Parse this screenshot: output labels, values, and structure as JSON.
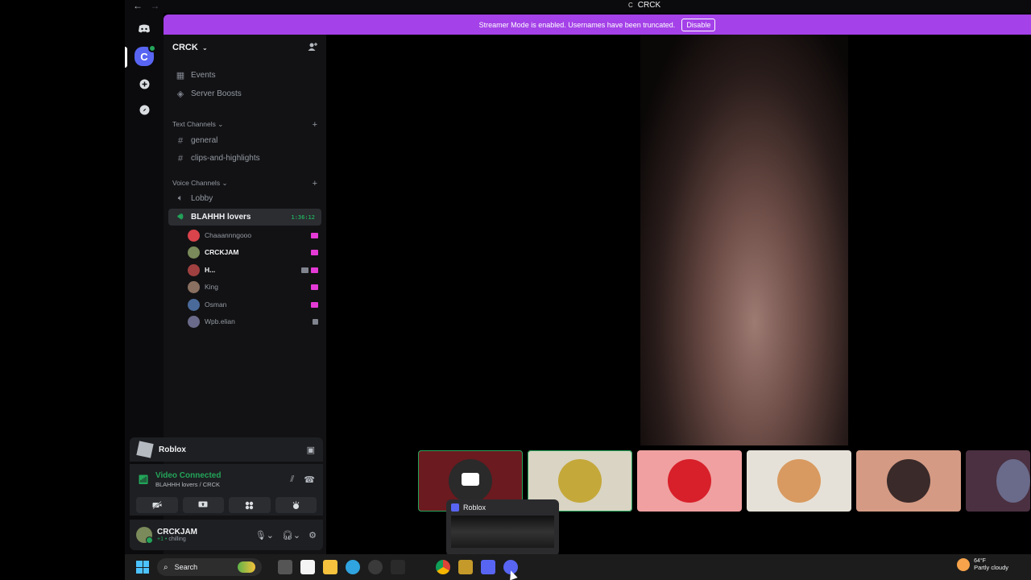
{
  "window": {
    "title": "CRCK",
    "title_icon": "C",
    "back": "←",
    "forward": "→"
  },
  "banner": {
    "message": "Streamer Mode is enabled. Usernames have been truncated.",
    "disable_label": "Disable"
  },
  "rail": {
    "server_initial": "C"
  },
  "server": {
    "name": "CRCK"
  },
  "sidebar": {
    "top_items": [
      {
        "label": "Events"
      },
      {
        "label": "Server Boosts"
      }
    ],
    "text_category": "Text Channels",
    "text_channels": [
      {
        "label": "general"
      },
      {
        "label": "clips-and-highlights"
      }
    ],
    "voice_category": "Voice Channels",
    "voice_channels": [
      {
        "label": "Lobby"
      },
      {
        "label": "BLAHHH lovers",
        "timer": "1:36:12"
      }
    ],
    "members": [
      {
        "name": "Chaaannngooo",
        "avatar_color": "#d9434b"
      },
      {
        "name": "CRCKJAM",
        "avatar_color": "#7a8a5a"
      },
      {
        "name": "H...",
        "avatar_color": "#a04040"
      },
      {
        "name": "King",
        "avatar_color": "#8a7060"
      },
      {
        "name": "Osman",
        "avatar_color": "#4a6a9a"
      },
      {
        "name": "Wpb.elian",
        "avatar_color": "#6a6a8a"
      }
    ]
  },
  "activity": {
    "game": "Roblox"
  },
  "rtc": {
    "status": "Video Connected",
    "channel": "BLAHHH lovers / CRCK"
  },
  "user": {
    "name": "CRCKJAM",
    "status": "chilling",
    "status_prefix": "+1 •"
  },
  "thumbnail": {
    "title": "Roblox"
  },
  "taskbar": {
    "search_placeholder": "Search"
  },
  "weather": {
    "temp": "64°F",
    "desc": "Partly cloudy"
  },
  "tiles": [
    {
      "bg": "#6b1a1f",
      "face": "#2a2a2a"
    },
    {
      "bg": "#d9d4c3",
      "face": "#c4a83a"
    },
    {
      "bg": "#f0a0a0",
      "face": "#d8202a"
    },
    {
      "bg": "#e6e1d8",
      "face": "#d89a60"
    },
    {
      "bg": "#d49a84",
      "face": "#3a2a2a"
    },
    {
      "bg": "#4a3040",
      "face": "#6a6a8a"
    }
  ]
}
